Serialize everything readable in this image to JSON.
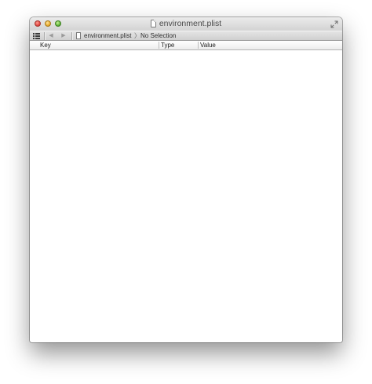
{
  "window": {
    "title": "environment.plist",
    "traffic_lights": {
      "close_icon": "close-icon",
      "minimize_icon": "minimize-icon",
      "zoom_icon": "zoom-icon"
    },
    "fullscreen_icon": "fullscreen-icon"
  },
  "jump_bar": {
    "grid_icon": "related-items-grid-icon",
    "back_icon": "back-arrow-icon",
    "forward_icon": "forward-arrow-icon",
    "back_glyph": "◀",
    "forward_glyph": "▶",
    "file_crumb": "environment.plist",
    "chevron": "〉",
    "selection_crumb": "No Selection"
  },
  "table": {
    "columns": [
      "Key",
      "Type",
      "Value"
    ],
    "rows": []
  },
  "colors": {
    "close": "#e0443e",
    "minimize": "#e8a92a",
    "zoom": "#5cb135",
    "titlebar_top": "#ebebeb",
    "titlebar_bottom": "#d3d3d3"
  }
}
